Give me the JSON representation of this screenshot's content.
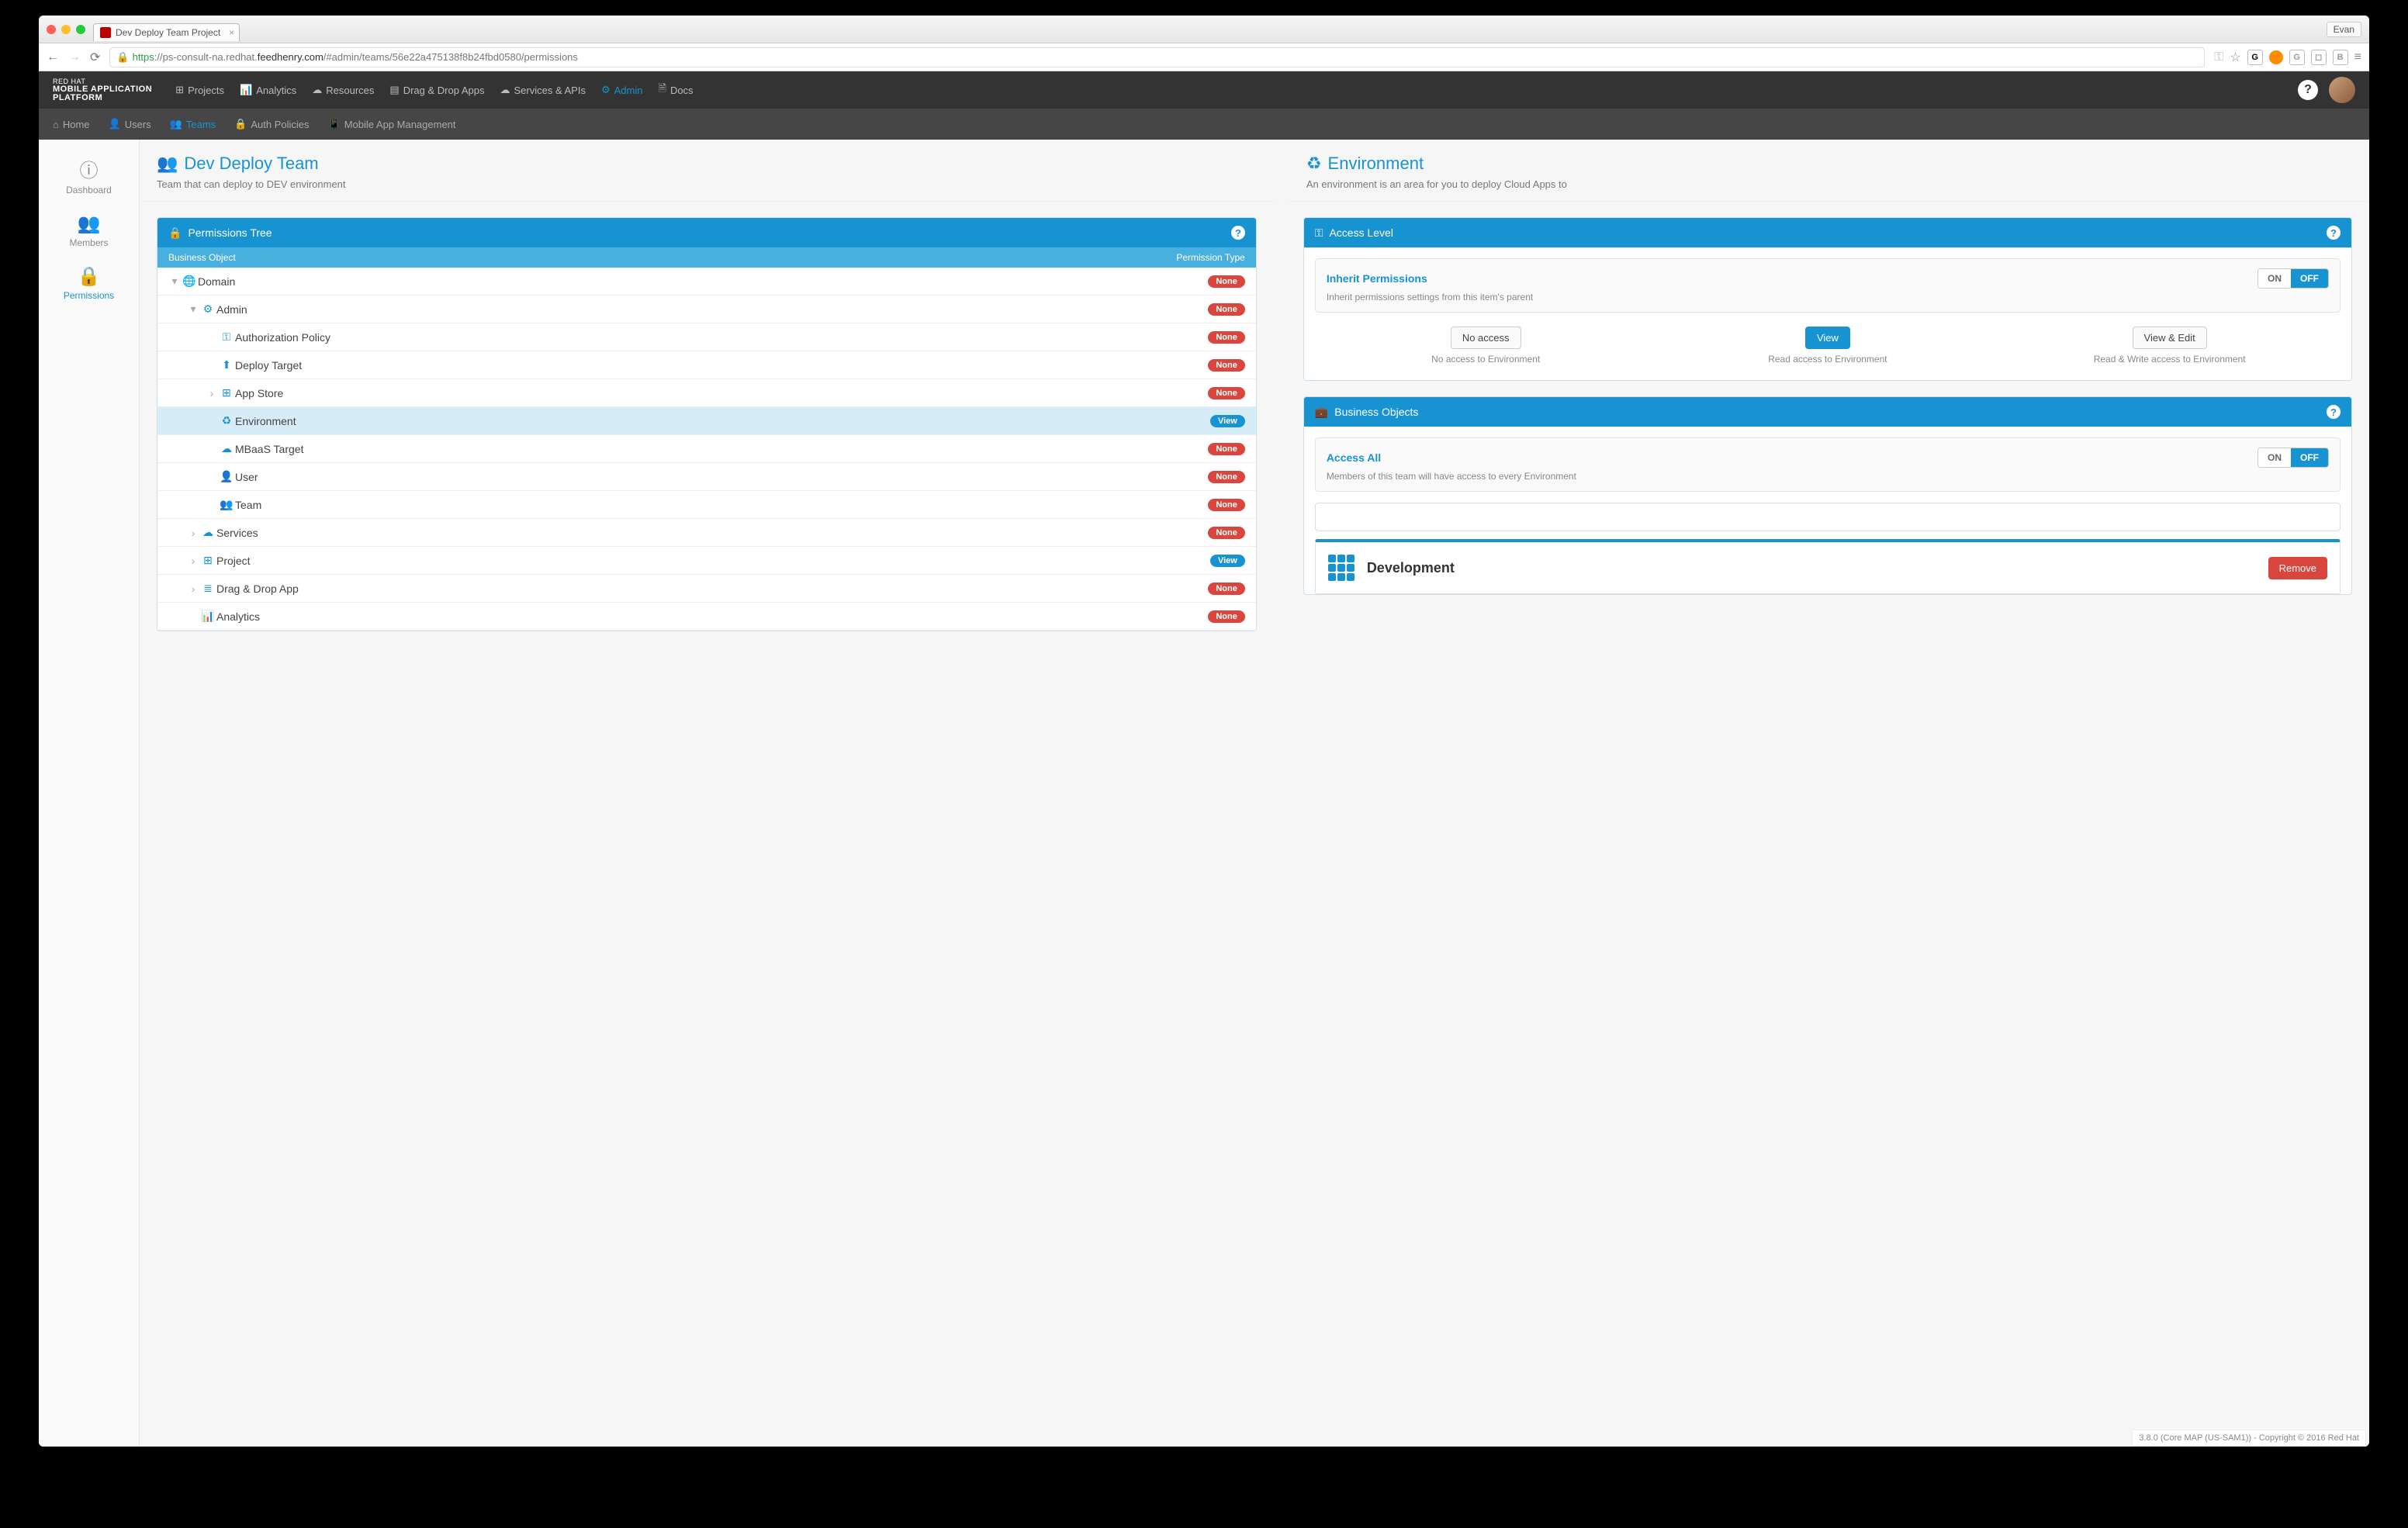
{
  "chrome": {
    "tab_title": "Dev Deploy Team Project",
    "user_chip": "Evan",
    "url": {
      "scheme": "https",
      "host_pre": "://ps-consult-na.redhat.",
      "host_main": "feedhenry.com",
      "rest": "/#admin/teams/56e22a475138f8b24fbd0580/permissions"
    }
  },
  "brand": {
    "line1": "RED HAT",
    "line2": "MOBILE APPLICATION",
    "line3": "PLATFORM"
  },
  "primary_nav": {
    "projects": "Projects",
    "analytics": "Analytics",
    "resources": "Resources",
    "dnd": "Drag & Drop Apps",
    "services": "Services & APIs",
    "admin": "Admin",
    "docs": "Docs"
  },
  "secondary_nav": {
    "home": "Home",
    "users": "Users",
    "teams": "Teams",
    "auth": "Auth Policies",
    "mam": "Mobile App Management"
  },
  "side": {
    "dashboard": "Dashboard",
    "members": "Members",
    "permissions": "Permissions"
  },
  "left_pane": {
    "title": "Dev Deploy Team",
    "desc": "Team that can deploy to DEV environment",
    "panel_title": "Permissions Tree",
    "col1": "Business Object",
    "col2": "Permission Type"
  },
  "tree": [
    {
      "indent": 0,
      "chev": "▾",
      "icon": "globe",
      "label": "Domain",
      "pill": "None",
      "pill_type": "none"
    },
    {
      "indent": 1,
      "chev": "▾",
      "icon": "gear",
      "label": "Admin",
      "pill": "None",
      "pill_type": "none"
    },
    {
      "indent": 2,
      "chev": "",
      "icon": "key",
      "label": "Authorization Policy",
      "pill": "None",
      "pill_type": "none"
    },
    {
      "indent": 2,
      "chev": "",
      "icon": "upload",
      "label": "Deploy Target",
      "pill": "None",
      "pill_type": "none"
    },
    {
      "indent": 2,
      "chev": "›",
      "icon": "grid",
      "label": "App Store",
      "pill": "None",
      "pill_type": "none"
    },
    {
      "indent": 2,
      "chev": "",
      "icon": "recycle",
      "label": "Environment",
      "pill": "View",
      "pill_type": "view",
      "selected": true
    },
    {
      "indent": 2,
      "chev": "",
      "icon": "cloud",
      "label": "MBaaS Target",
      "pill": "None",
      "pill_type": "none"
    },
    {
      "indent": 2,
      "chev": "",
      "icon": "user",
      "label": "User",
      "pill": "None",
      "pill_type": "none"
    },
    {
      "indent": 2,
      "chev": "",
      "icon": "users",
      "label": "Team",
      "pill": "None",
      "pill_type": "none"
    },
    {
      "indent": 1,
      "chev": "›",
      "icon": "cloud",
      "label": "Services",
      "pill": "None",
      "pill_type": "none"
    },
    {
      "indent": 1,
      "chev": "›",
      "icon": "grid",
      "label": "Project",
      "pill": "View",
      "pill_type": "view"
    },
    {
      "indent": 1,
      "chev": "›",
      "icon": "list",
      "label": "Drag & Drop App",
      "pill": "None",
      "pill_type": "none"
    },
    {
      "indent": 1,
      "chev": "",
      "icon": "chart",
      "label": "Analytics",
      "pill": "None",
      "pill_type": "none"
    }
  ],
  "right_pane": {
    "title": "Environment",
    "desc": "An environment is an area for you to deploy Cloud Apps to"
  },
  "access_level": {
    "panel_title": "Access Level",
    "inherit_title": "Inherit Permissions",
    "inherit_sub": "Inherit permissions settings from this item's parent",
    "on": "ON",
    "off": "OFF",
    "no_access": {
      "btn": "No access",
      "desc": "No access to Environment"
    },
    "view": {
      "btn": "View",
      "desc": "Read access to Environment"
    },
    "view_edit": {
      "btn": "View & Edit",
      "desc": "Read & Write access to Environment"
    }
  },
  "business_objects": {
    "panel_title": "Business Objects",
    "access_all_title": "Access All",
    "access_all_sub": "Members of this team will have access to every Environment",
    "on": "ON",
    "off": "OFF",
    "item1": {
      "name": "Development",
      "remove": "Remove"
    }
  },
  "footer": "3.8.0 (Core MAP (US-SAM1)) - Copyright © 2016 Red Hat"
}
